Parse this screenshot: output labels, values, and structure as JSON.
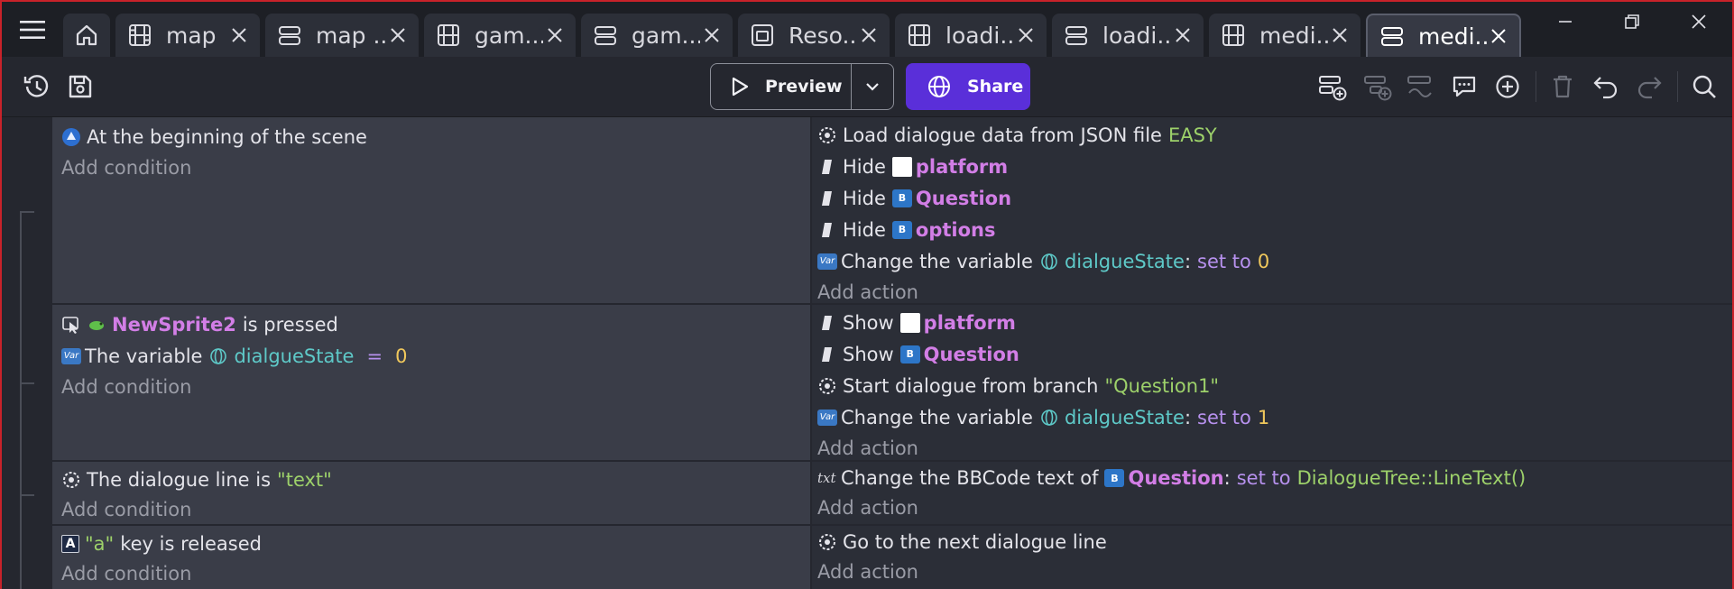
{
  "tabs": [
    {
      "label": "",
      "icon": "home-icon",
      "type": "home"
    },
    {
      "label": "map",
      "icon": "film-icon"
    },
    {
      "label": "map ...",
      "icon": "events-icon"
    },
    {
      "label": "gam...",
      "icon": "film-icon"
    },
    {
      "label": "gam...",
      "icon": "events-icon"
    },
    {
      "label": "Reso...",
      "icon": "resources-icon"
    },
    {
      "label": "loadi...",
      "icon": "film-icon"
    },
    {
      "label": "loadi...",
      "icon": "events-icon"
    },
    {
      "label": "medi...",
      "icon": "film-icon"
    },
    {
      "label": "medi...",
      "icon": "events-icon",
      "active": true
    }
  ],
  "toolbar": {
    "preview_label": "Preview",
    "share_label": "Share"
  },
  "colors": {
    "share": "#5a2fd9",
    "object": "#d27ee6",
    "variable": "#5ec9c8",
    "operator": "#b791ee",
    "number": "#f0c85c",
    "string": "#9dd16a"
  },
  "events": [
    {
      "conditions": [
        {
          "text": "At the beginning of the scene"
        }
      ],
      "actions": [
        {
          "text": "Load dialogue data from JSON file",
          "value": "EASY"
        },
        {
          "verb": "Hide",
          "object": "platform"
        },
        {
          "verb": "Hide",
          "object": "Question"
        },
        {
          "verb": "Hide",
          "object": "options"
        },
        {
          "text": "Change the variable",
          "variable": "dialgueState",
          "op": "set to",
          "value": "0"
        }
      ]
    },
    {
      "conditions": [
        {
          "object": "NewSprite2",
          "text": "is pressed"
        },
        {
          "text": "The variable",
          "variable": "dialgueState",
          "op": "=",
          "value": "0"
        }
      ],
      "actions": [
        {
          "verb": "Show",
          "object": "platform"
        },
        {
          "verb": "Show",
          "object": "Question"
        },
        {
          "text": "Start dialogue from branch",
          "value": "\"Question1\""
        },
        {
          "text": "Change the variable",
          "variable": "dialgueState",
          "op": "set to",
          "value": "1"
        }
      ]
    },
    {
      "conditions": [
        {
          "text": "The dialogue line is",
          "value": "\"text\""
        }
      ],
      "actions": [
        {
          "text": "Change the BBCode text of",
          "object": "Question",
          "op": "set to",
          "value": "DialogueTree::LineText()"
        }
      ]
    },
    {
      "conditions": [
        {
          "value": "\"a\"",
          "text": "key is released"
        }
      ],
      "actions": [
        {
          "text": "Go to the next dialogue line"
        }
      ]
    }
  ],
  "add_condition_label": "Add condition",
  "add_action_label": "Add action",
  "badges": {
    "variable": "Var",
    "text_object": "txt",
    "key": "A",
    "bbcode": "B"
  }
}
